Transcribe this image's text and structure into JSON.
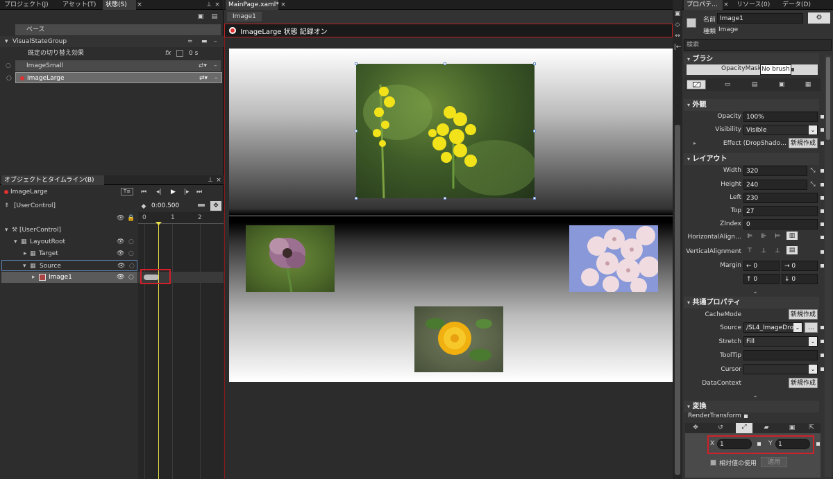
{
  "left_tabs": [
    "プロジェクト(J)",
    "アセット(T)",
    "状態(S)"
  ],
  "states": {
    "base_label": "ベース",
    "group_name": "VisualStateGroup",
    "default_transition_label": "既定の切り替え効果",
    "default_transition_value": "0 s",
    "items": [
      "ImageSmall",
      "ImageLarge"
    ]
  },
  "objects": {
    "panel_title": "オブジェクトとタイムライン(B)",
    "recording_state": "ImageLarge",
    "root_label": "[UserControl]",
    "time": "0:00.500",
    "ruler": [
      "0",
      "1",
      "2"
    ],
    "tree": [
      "[UserControl]",
      "LayoutRoot",
      "Target",
      "Source",
      "Image1"
    ]
  },
  "doc": {
    "tab": "MainPage.xaml*",
    "breadcrumb": "Image1",
    "recording_text": "ImageLarge 状態 記録オン"
  },
  "props": {
    "tabs": [
      "プロパテ…",
      "リソース(0)",
      "データ(D)"
    ],
    "name_label": "名前",
    "name_value": "Image1",
    "type_label": "種類",
    "type_value": "Image",
    "search_placeholder": "検索",
    "brush": {
      "title": "ブラシ",
      "opacity_mask": "OpacityMask",
      "no_brush": "No brush"
    },
    "appearance": {
      "title": "外観",
      "opacity_label": "Opacity",
      "opacity_value": "100%",
      "visibility_label": "Visibility",
      "visibility_value": "Visible",
      "effect_label": "Effect (DropShado…",
      "effect_button": "新規作成"
    },
    "layout": {
      "title": "レイアウト",
      "width_label": "Width",
      "width_value": "320",
      "height_label": "Height",
      "height_value": "240",
      "left_label": "Left",
      "left_value": "230",
      "top_label": "Top",
      "top_value": "27",
      "zindex_label": "ZIndex",
      "zindex_value": "0",
      "halign_label": "HorizontalAlign…",
      "valign_label": "VerticalAlignment",
      "margin_label": "Margin",
      "margin_values": [
        "0",
        "0",
        "0",
        "0"
      ]
    },
    "common": {
      "title": "共通プロパティ",
      "cachemode_label": "CacheMode",
      "cachemode_button": "新規作成",
      "source_label": "Source",
      "source_value": "/SL4_ImageDro",
      "stretch_label": "Stretch",
      "stretch_value": "Fill",
      "tooltip_label": "ToolTip",
      "tooltip_value": "",
      "cursor_label": "Cursor",
      "cursor_value": "",
      "datacontext_label": "DataContext",
      "datacontext_button": "新規作成"
    },
    "transform": {
      "title": "変換",
      "render_label": "RenderTransform",
      "x_label": "X",
      "x_value": "1",
      "y_label": "Y",
      "y_value": "1",
      "relative_label": "相対値の使用",
      "apply_button": "適用"
    }
  },
  "colors": {
    "highlight_box": "#d0202a",
    "playhead": "#e8e048",
    "record": "#e03030",
    "selection": "#6a8fcf"
  }
}
